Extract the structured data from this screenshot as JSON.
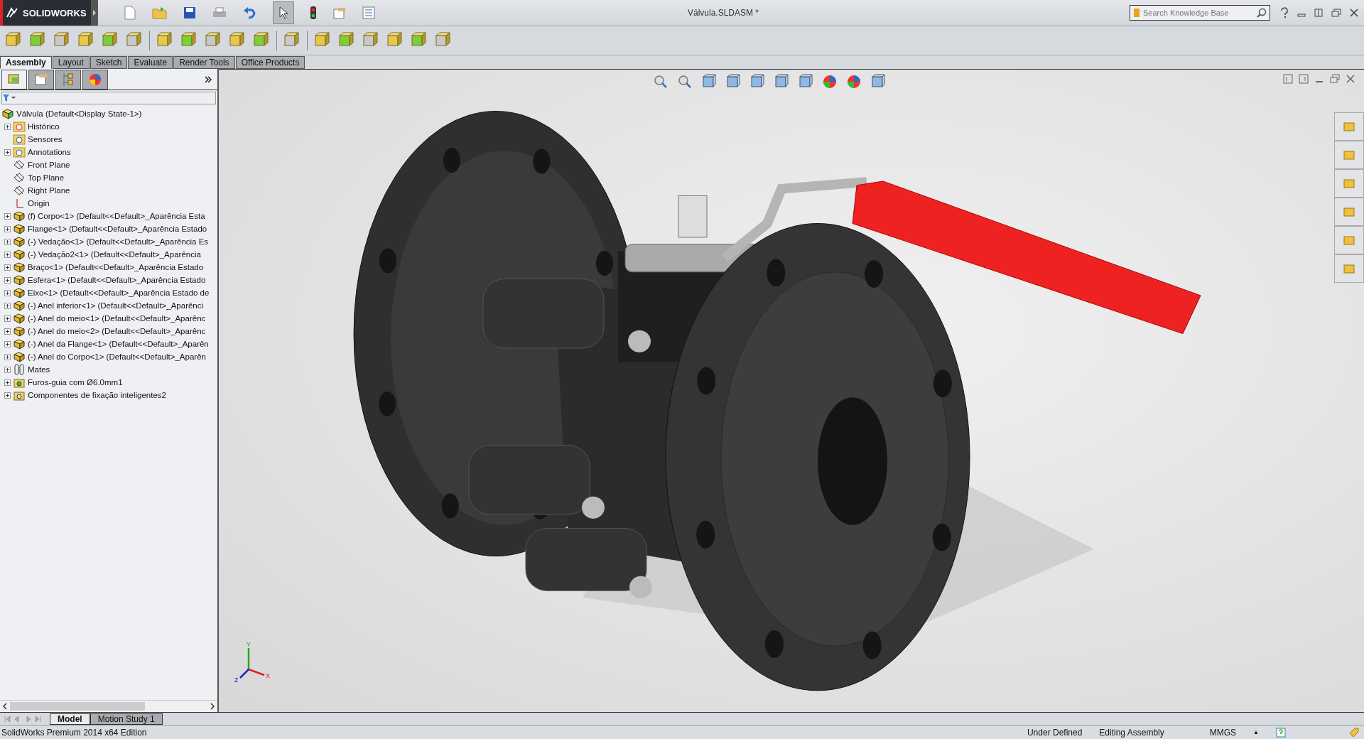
{
  "app": {
    "brand": "SOLIDWORKS",
    "document_title": "Válvula.SLDASM *"
  },
  "search": {
    "placeholder": "Search Knowledge Base"
  },
  "command_tabs": [
    {
      "label": "Assembly",
      "selected": true
    },
    {
      "label": "Layout",
      "selected": false
    },
    {
      "label": "Sketch",
      "selected": false
    },
    {
      "label": "Evaluate",
      "selected": false
    },
    {
      "label": "Render Tools",
      "selected": false
    },
    {
      "label": "Office Products",
      "selected": false
    }
  ],
  "feature_tree": {
    "root": {
      "label": "Válvula  (Default<Display State-1>)",
      "kind": "assembly",
      "children": [
        {
          "label": "Histórico",
          "kind": "history",
          "expander": true
        },
        {
          "label": "Sensores",
          "kind": "sensor",
          "expander": false
        },
        {
          "label": "Annotations",
          "kind": "annotation",
          "expander": true
        },
        {
          "label": "Front Plane",
          "kind": "plane",
          "expander": false
        },
        {
          "label": "Top Plane",
          "kind": "plane",
          "expander": false
        },
        {
          "label": "Right Plane",
          "kind": "plane",
          "expander": false
        },
        {
          "label": "Origin",
          "kind": "origin",
          "expander": false
        },
        {
          "label": "(f) Corpo<1> (Default<<Default>_Aparência Esta",
          "kind": "part",
          "expander": true
        },
        {
          "label": "Flange<1> (Default<<Default>_Aparência Estado",
          "kind": "part",
          "expander": true
        },
        {
          "label": "(-) Vedação<1> (Default<<Default>_Aparência Es",
          "kind": "part",
          "expander": true
        },
        {
          "label": "(-) Vedação2<1> (Default<<Default>_Aparência",
          "kind": "part",
          "expander": true
        },
        {
          "label": "Braço<1> (Default<<Default>_Aparência Estado",
          "kind": "part",
          "expander": true
        },
        {
          "label": "Esfera<1> (Default<<Default>_Aparência Estado",
          "kind": "part",
          "expander": true
        },
        {
          "label": "Eixo<1> (Default<<Default>_Aparência Estado de",
          "kind": "part",
          "expander": true
        },
        {
          "label": "(-) Anel inferior<1> (Default<<Default>_Aparênci",
          "kind": "part",
          "expander": true
        },
        {
          "label": "(-) Anel do meio<1> (Default<<Default>_Aparênc",
          "kind": "part",
          "expander": true
        },
        {
          "label": "(-) Anel do meio<2> (Default<<Default>_Aparênc",
          "kind": "part",
          "expander": true
        },
        {
          "label": "(-) Anel da Flange<1> (Default<<Default>_Aparên",
          "kind": "part",
          "expander": true
        },
        {
          "label": "(-) Anel do Corpo<1> (Default<<Default>_Aparên",
          "kind": "part",
          "expander": true
        },
        {
          "label": "Mates",
          "kind": "mates",
          "expander": true
        },
        {
          "label": "Furos-guia com Ø6.0mm1",
          "kind": "hole",
          "expander": true
        },
        {
          "label": "Componentes de fixação inteligentes2",
          "kind": "fastener",
          "expander": true
        }
      ]
    }
  },
  "triad": {
    "y": "Y",
    "x": "X",
    "z": "Z"
  },
  "bottom_tabs": [
    {
      "label": "Model",
      "selected": true
    },
    {
      "label": "Motion Study 1",
      "selected": false
    }
  ],
  "status_bar": {
    "edition": "SolidWorks Premium 2014 x64 Edition",
    "definition": "Under Defined",
    "mode": "Editing Assembly",
    "units": "MMGS",
    "units_caret": "▲"
  }
}
